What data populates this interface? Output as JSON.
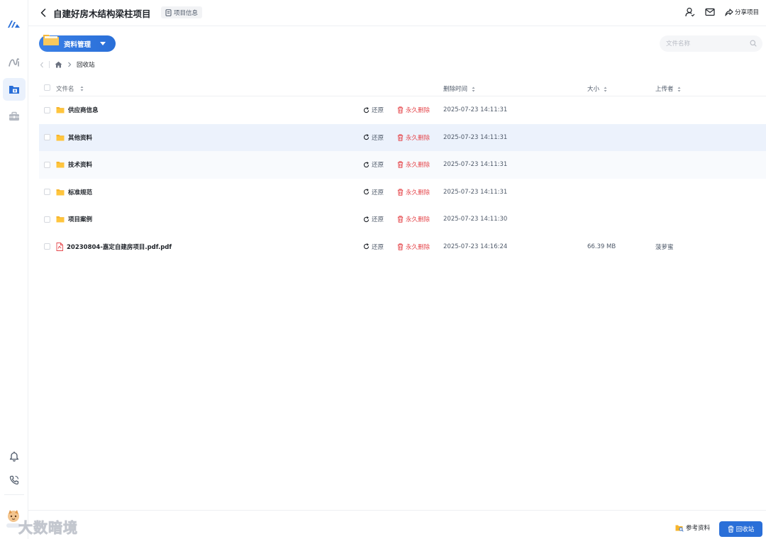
{
  "header": {
    "title": "自建好房木结构梁柱项目",
    "project_info_label": "项目信息",
    "share_label": "分享项目"
  },
  "toolbar": {
    "resource_button_label": "资料管理",
    "search_placeholder": "文件名称"
  },
  "breadcrumb": {
    "current": "回收站"
  },
  "table": {
    "columns": {
      "name": "文件名",
      "deleted_time": "删除时间",
      "size": "大小",
      "uploader": "上传者"
    },
    "restore_label": "还原",
    "delete_label": "永久删除",
    "rows": [
      {
        "type": "folder",
        "name": "供应商信息",
        "deleted_time": "2025-07-23 14:11:31",
        "size": "",
        "uploader": ""
      },
      {
        "type": "folder",
        "name": "其他资料",
        "deleted_time": "2025-07-23 14:11:31",
        "size": "",
        "uploader": ""
      },
      {
        "type": "folder",
        "name": "技术资料",
        "deleted_time": "2025-07-23 14:11:31",
        "size": "",
        "uploader": ""
      },
      {
        "type": "folder",
        "name": "标准规范",
        "deleted_time": "2025-07-23 14:11:31",
        "size": "",
        "uploader": ""
      },
      {
        "type": "folder",
        "name": "项目案例",
        "deleted_time": "2025-07-23 14:11:30",
        "size": "",
        "uploader": ""
      },
      {
        "type": "pdf",
        "name": "20230804-嘉定自建房项目.pdf.pdf",
        "deleted_time": "2025-07-23 14:16:24",
        "size": "66.39 MB",
        "uploader": "菠萝蜜"
      }
    ]
  },
  "footer": {
    "reference_label": "参考资料",
    "recycle_bin_label": "回收站"
  },
  "watermark": "大数暗境",
  "colors": {
    "primary": "#2a6fd8",
    "danger": "#e5484d",
    "folder": "#f7b52c",
    "row_highlight": "#ecf2fc"
  }
}
